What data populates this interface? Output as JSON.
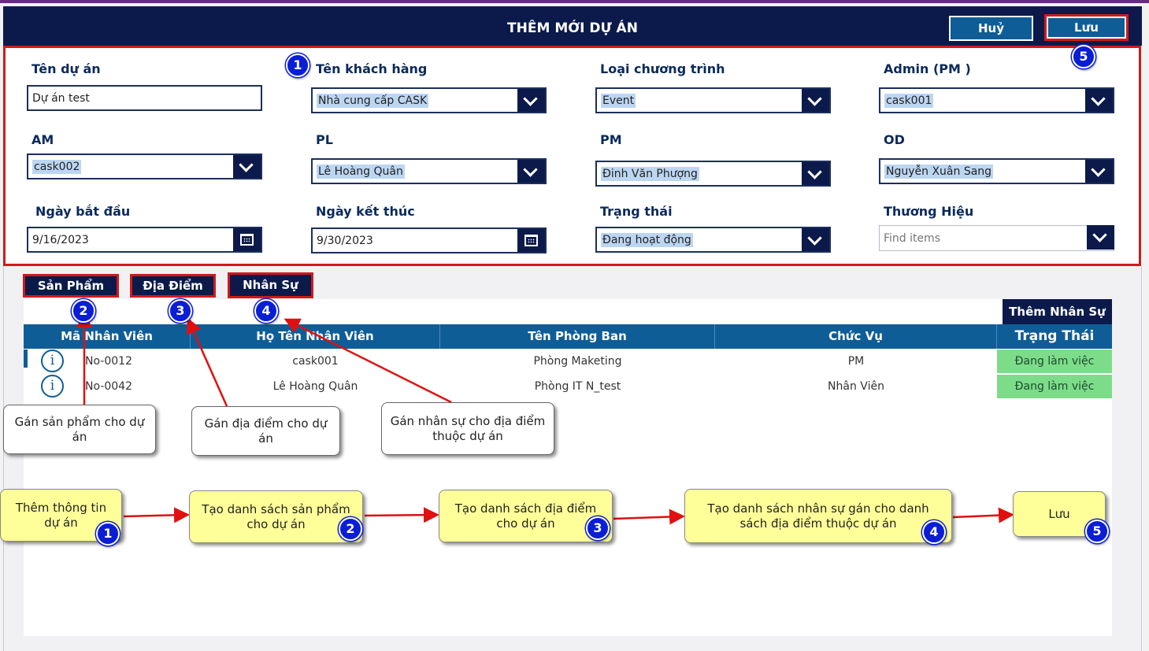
{
  "header": {
    "title": "THÊM MỚI DỰ ÁN",
    "cancel_label": "Huỷ",
    "save_label": "Lưu"
  },
  "form": {
    "project_name": {
      "label": "Tên dự án",
      "value": "Dự án test"
    },
    "customer": {
      "label": "Tên khách hàng",
      "value": "Nhà cung cấp CASK"
    },
    "program_type": {
      "label": "Loại chương trình",
      "value": "Event"
    },
    "admin": {
      "label": "Admin (PM )",
      "value": "cask001"
    },
    "am": {
      "label": "AM",
      "value": "cask002"
    },
    "pl": {
      "label": "PL",
      "value": "Lê Hoàng Quân"
    },
    "pm": {
      "label": "PM",
      "value": "Đinh Văn Phượng"
    },
    "od": {
      "label": "OD",
      "value": "Nguyễn Xuân Sang"
    },
    "start_date": {
      "label": "Ngày bắt đầu",
      "value": "9/16/2023"
    },
    "end_date": {
      "label": "Ngày kết thúc",
      "value": "9/30/2023"
    },
    "status": {
      "label": "Trạng thái",
      "value": "Đang hoạt động"
    },
    "brand": {
      "label": "Thương Hiệu",
      "placeholder": "Find items"
    }
  },
  "tabs": [
    {
      "label": "Sản Phẩm"
    },
    {
      "label": "Địa Điểm"
    },
    {
      "label": "Nhân Sự"
    }
  ],
  "add_staff_label": "Thêm Nhân Sự",
  "table": {
    "columns": [
      "Mã Nhân Viên",
      "Họ Tên Nhân Viên",
      "Tên Phòng Ban",
      "Chức Vụ",
      "Trạng Thái"
    ],
    "rows": [
      {
        "code": "No-0012",
        "name": "cask001",
        "department": "Phòng Maketing",
        "position": "PM",
        "status": "Đang làm việc"
      },
      {
        "code": "No-0042",
        "name": "Lê Hoàng Quân",
        "department": "Phòng IT N_test",
        "position": "Nhân Viên",
        "status": "Đang làm việc"
      }
    ]
  },
  "badges": [
    "1",
    "2",
    "3",
    "4",
    "5"
  ],
  "callouts": {
    "product": "Gán sản phẩm cho dự án",
    "location": "Gán địa điểm cho dự án",
    "staff": "Gán nhân sự cho địa điểm thuộc dự án"
  },
  "steps": [
    "Thêm thông tin dự án",
    "Tạo danh sách sản phẩm cho dự án",
    "Tạo danh sách địa điểm cho dự án",
    "Tạo danh sách nhân sự gán cho danh sách địa điểm thuộc dự án",
    "Lưu"
  ],
  "colors": {
    "header_bg": "#0b1a4a",
    "accent_blue": "#0f5d97",
    "highlight_red": "#d01a1a",
    "status_green": "#7ddc8a",
    "step_yellow": "#ffff99",
    "badge_blue": "#0a1ed6"
  }
}
